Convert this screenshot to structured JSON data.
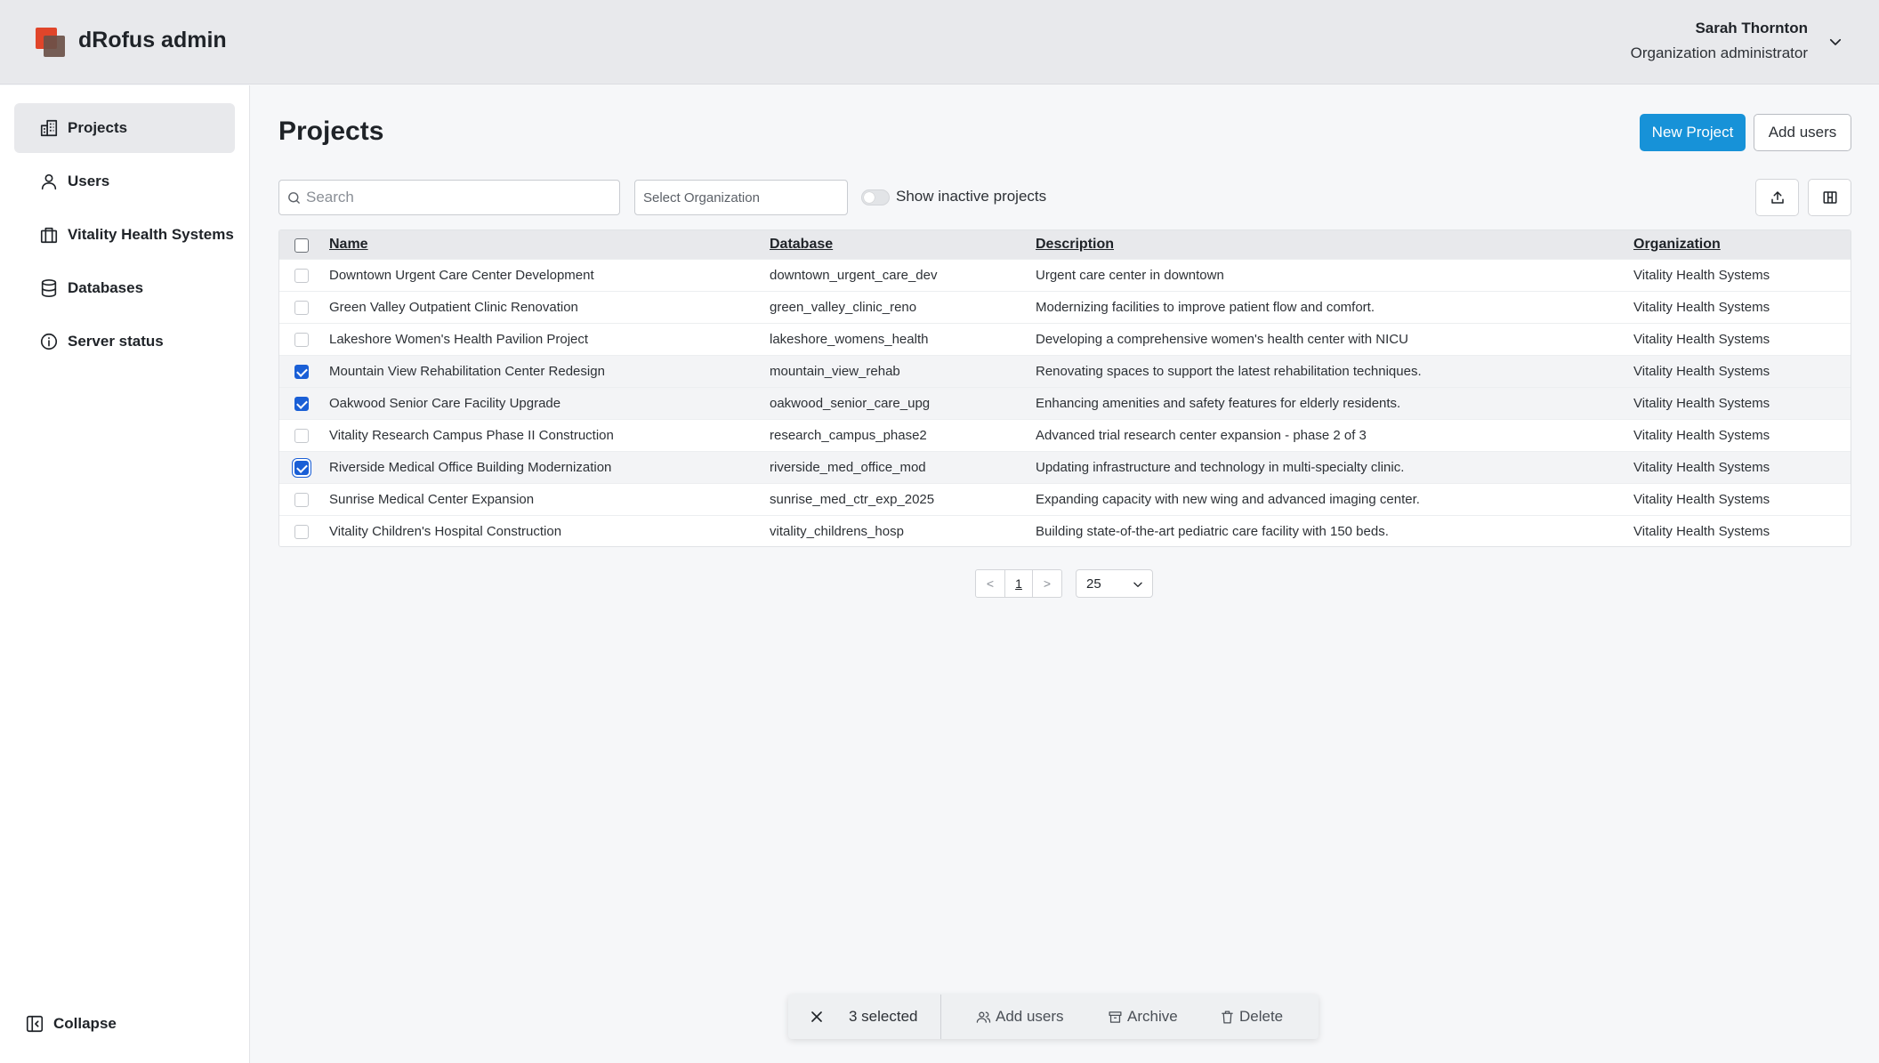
{
  "app": {
    "title": "dRofus admin"
  },
  "user": {
    "name": "Sarah Thornton",
    "role": "Organization administrator"
  },
  "sidebar": {
    "items": [
      {
        "label": "Projects",
        "icon": "building-icon",
        "active": true
      },
      {
        "label": "Users",
        "icon": "user-icon"
      },
      {
        "label": "Vitality Health Systems",
        "icon": "briefcase-icon"
      },
      {
        "label": "Databases",
        "icon": "database-icon"
      },
      {
        "label": "Server status",
        "icon": "info-icon"
      }
    ],
    "collapse_label": "Collapse"
  },
  "page": {
    "title": "Projects",
    "new_project_label": "New Project",
    "add_users_label": "Add users",
    "search_placeholder": "Search",
    "org_placeholder": "Select Organization",
    "show_inactive_label": "Show inactive projects"
  },
  "table": {
    "headers": {
      "name": "Name",
      "database": "Database",
      "description": "Description",
      "organization": "Organization"
    },
    "rows": [
      {
        "name": "Downtown Urgent Care Center Development",
        "database": "downtown_urgent_care_dev",
        "description": "Urgent care center in downtown",
        "organization": "Vitality Health Systems",
        "selected": false
      },
      {
        "name": "Green Valley Outpatient Clinic Renovation",
        "database": "green_valley_clinic_reno",
        "description": "Modernizing facilities to improve patient flow and comfort.",
        "organization": "Vitality Health Systems",
        "selected": false
      },
      {
        "name": "Lakeshore Women's Health Pavilion Project",
        "database": "lakeshore_womens_health",
        "description": "Developing a comprehensive women's health center with NICU",
        "organization": "Vitality Health Systems",
        "selected": false
      },
      {
        "name": "Mountain View Rehabilitation Center Redesign",
        "database": "mountain_view_rehab",
        "description": "Renovating spaces to support the latest rehabilitation techniques.",
        "organization": "Vitality Health Systems",
        "selected": true
      },
      {
        "name": "Oakwood Senior Care Facility Upgrade",
        "database": "oakwood_senior_care_upg",
        "description": "Enhancing amenities and safety features for elderly residents.",
        "organization": "Vitality Health Systems",
        "selected": true
      },
      {
        "name": "Vitality Research Campus Phase II Construction",
        "database": "research_campus_phase2",
        "description": "Advanced trial research center expansion - phase 2 of 3",
        "organization": "Vitality Health Systems",
        "selected": false
      },
      {
        "name": "Riverside Medical Office Building Modernization",
        "database": "riverside_med_office_mod",
        "description": "Updating infrastructure and technology in multi-specialty clinic.",
        "organization": "Vitality Health Systems",
        "selected": true
      },
      {
        "name": "Sunrise Medical Center Expansion",
        "database": "sunrise_med_ctr_exp_2025",
        "description": "Expanding capacity with new wing and advanced imaging center.",
        "organization": "Vitality Health Systems",
        "selected": false
      },
      {
        "name": "Vitality Children's Hospital Construction",
        "database": "vitality_childrens_hosp",
        "description": "Building state-of-the-art pediatric care facility with 150 beds.",
        "organization": "Vitality Health Systems",
        "selected": false
      }
    ]
  },
  "pagination": {
    "prev": "<",
    "current": "1",
    "next": ">",
    "page_size": "25"
  },
  "selection_bar": {
    "count_label": "3 selected",
    "add_users_label": "Add users",
    "archive_label": "Archive",
    "delete_label": "Delete"
  },
  "colors": {
    "primary": "#1792d8",
    "brand_red": "#e0452a",
    "checkbox": "#1a5fd6"
  }
}
